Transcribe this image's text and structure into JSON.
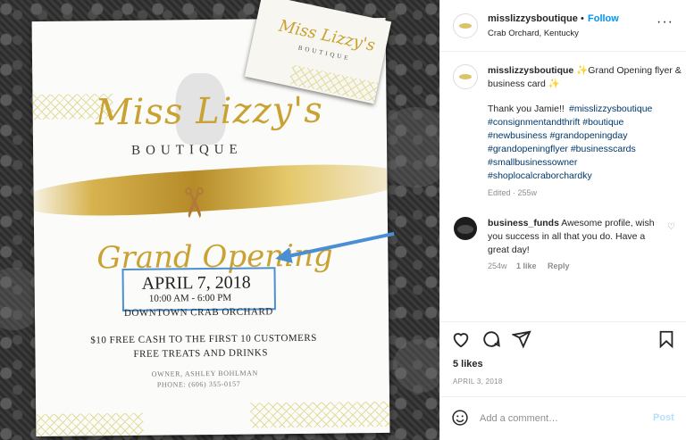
{
  "photo": {
    "flyer": {
      "brand_name": "Miss Lizzy's",
      "brand_sub": "BOUTIQUE",
      "headline": "Grand Opening",
      "date": "APRIL 7, 2018",
      "time": "10:00 AM - 6:00 PM",
      "place": "DOWNTOWN CRAB ORCHARD",
      "offer_line_1": "$10 FREE CASH TO THE FIRST 10 CUSTOMERS",
      "offer_line_2": "FREE TREATS AND DRINKS",
      "owner": "OWNER, ASHLEY BOHLMAN",
      "phone": "PHONE: (606) 355-0157"
    },
    "card": {
      "brand_name": "Miss Lizzy's",
      "brand_sub": "BOUTIQUE"
    },
    "accent_colors": {
      "gold": "#c9a233",
      "annotation_blue": "#4a8fd4"
    }
  },
  "header": {
    "username": "misslizzysboutique",
    "separator": "•",
    "follow_label": "Follow",
    "location": "Crab Orchard, Kentucky",
    "more_icon": "···"
  },
  "caption": {
    "username": "misslizzysboutique",
    "text_line": "✨Grand Opening flyer & business card ✨",
    "thanks": "Thank you Jamie!! ",
    "hashtags": "#misslizzysboutique #consignmentandthrift #boutique #newbusiness #grandopeningday #grandopeningflyer #businesscards #smallbusinessowner #shoplocalcraborchardky",
    "edited": "Edited · 255w"
  },
  "comment": {
    "username": "business_funds",
    "text": "Awesome profile, wish you success in all that you do. Have a great day!",
    "age": "254w",
    "likes": "1 like",
    "reply": "Reply"
  },
  "actions": {
    "like_icon": "heart-icon",
    "comment_icon": "comment-icon",
    "share_icon": "share-icon",
    "save_icon": "bookmark-icon"
  },
  "likes_label": "5 likes",
  "post_date": "APRIL 3, 2018",
  "comment_bar": {
    "placeholder": "Add a comment…",
    "post_label": "Post",
    "emoji_icon": "emoji-icon"
  },
  "colors": {
    "link_blue": "#0095f6",
    "hashtag_blue": "#00376b",
    "muted": "#8e8e8e"
  }
}
